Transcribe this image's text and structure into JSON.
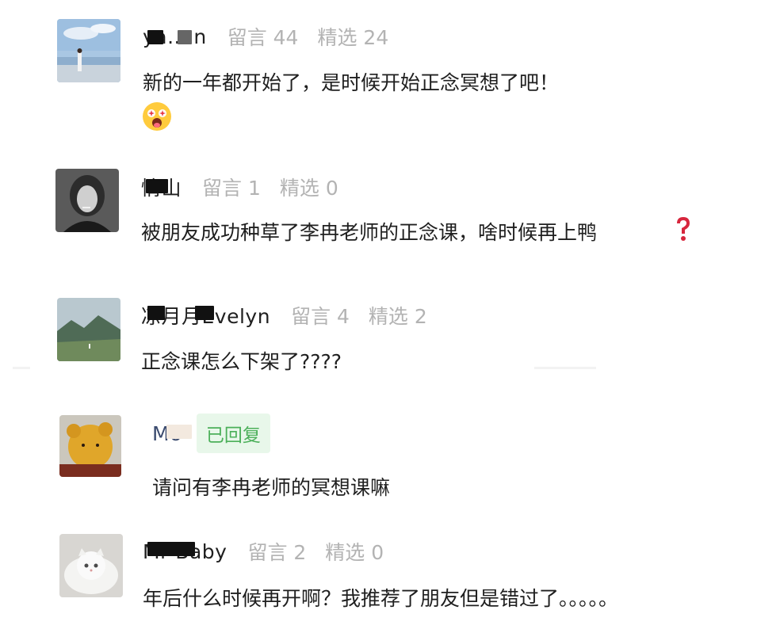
{
  "comments": [
    {
      "username": "ya..un",
      "comments_label": "留言 44",
      "featured_label": "精选 24",
      "text": "新的一年都开始了，是时候开始正念冥想了吧！",
      "emoji": "starstruck-face-icon"
    },
    {
      "username": "情山",
      "comments_label": "留言 1",
      "featured_label": "精选 0",
      "text": "被朋友成功种草了李冉老师的正念课，啥时候再上鸭",
      "emoji": "red-question-mark-icon"
    },
    {
      "username": "凉月月Evelyn",
      "comments_label": "留言 4",
      "featured_label": "精选 2",
      "text": "正念课怎么下架了????"
    },
    {
      "username": "Mo",
      "badge": "已回复",
      "text": "请问有李冉老师的冥想课嘛"
    },
    {
      "username": "Mr Baby",
      "comments_label": "留言 2",
      "featured_label": "精选 0",
      "text": "年后什么时候再开啊？我推荐了朋友但是错过了。。。。。"
    }
  ],
  "colors": {
    "username": "#1f1f1f",
    "stat": "#b3b3b3",
    "badge_text": "#4cb05a",
    "badge_bg": "#e8f7ea"
  }
}
